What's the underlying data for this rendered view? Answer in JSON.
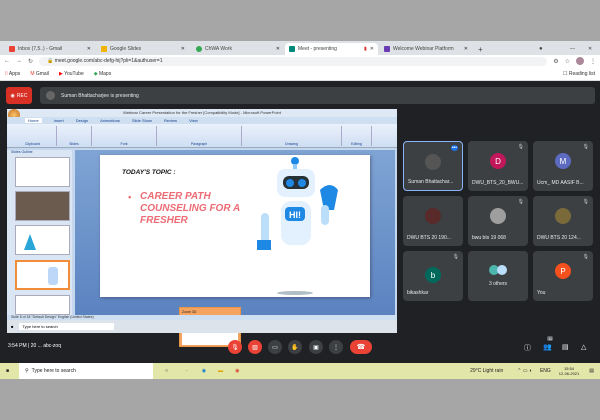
{
  "browser": {
    "tabs": [
      {
        "label": "Inbox (7,5..) - Gmail",
        "color": "#ea4335"
      },
      {
        "label": "Google Slides",
        "color": "#f4b400"
      },
      {
        "label": "ChWA Work",
        "color": "#34a853"
      },
      {
        "label": "Meet - presenting",
        "color": "#00897b"
      },
      {
        "label": "Welcome Webinar Platform",
        "color": "#6a3ab2"
      }
    ],
    "new_tab": "+",
    "url": "meet.google.com/abc-defg-hij?pli=1&authuser=1",
    "bookmarks": [
      "Apps",
      "Gmail",
      "YouTube",
      "Maps"
    ],
    "reading_list": "Reading list"
  },
  "meet": {
    "rec_label": "REC",
    "presenting_text": "Suman Bhattacharjee is presenting",
    "clock": "3:54 PM  |  20 ... abc-zoq",
    "participants": [
      {
        "name": "Suman Bhattachar...",
        "initial": "",
        "color": "#555"
      },
      {
        "name": "DWU_BTS_20_BWU...",
        "initial": "D",
        "color": "#c2185b"
      },
      {
        "name": "Ucm_ MD AASIF B...",
        "initial": "M",
        "color": "#5c6bc0"
      },
      {
        "name": "DWU BTS 20 190...",
        "initial": "",
        "color": "#5a2a2a"
      },
      {
        "name": "bwu bts 19 068",
        "initial": "",
        "color": "#9e9e9e"
      },
      {
        "name": "DWU BTS 20 124...",
        "initial": "",
        "color": "#7a6a3a"
      },
      {
        "name": "bikashkar",
        "initial": "b",
        "color": "#00695c"
      },
      {
        "name": "3 others",
        "initial": "",
        "color": "#4db6ac"
      },
      {
        "name": "You",
        "initial": "P",
        "color": "#f4511e"
      }
    ],
    "participant_count": "11"
  },
  "ppt": {
    "title": "Webinar Career Presentation for the Fresher [Compatibility Mode] - Microsoft PowerPoint",
    "tabs": [
      "Home",
      "Insert",
      "Design",
      "Animations",
      "Slide Show",
      "Review",
      "View"
    ],
    "groups": [
      "Clipboard",
      "Slides",
      "Font",
      "Paragraph",
      "Drawing",
      "Editing"
    ],
    "panel_tabs": [
      "Slides",
      "Outline"
    ],
    "slide": {
      "topic": "TODAY'S TOPIC :",
      "bullet": "CAREER PATH COUNSELING FOR A FRESHER",
      "robot_text": "HI!"
    },
    "status": "Slide 5 of 18   \"Default Design\"   English (United States)",
    "popup_title": "Zoom 3D",
    "search_placeholder": "Type here to search"
  },
  "taskbar": {
    "search_placeholder": "Type here to search",
    "weather": "29°C Light rain",
    "lang": "ENG",
    "time": "15:54",
    "date": "12-06-2021"
  }
}
